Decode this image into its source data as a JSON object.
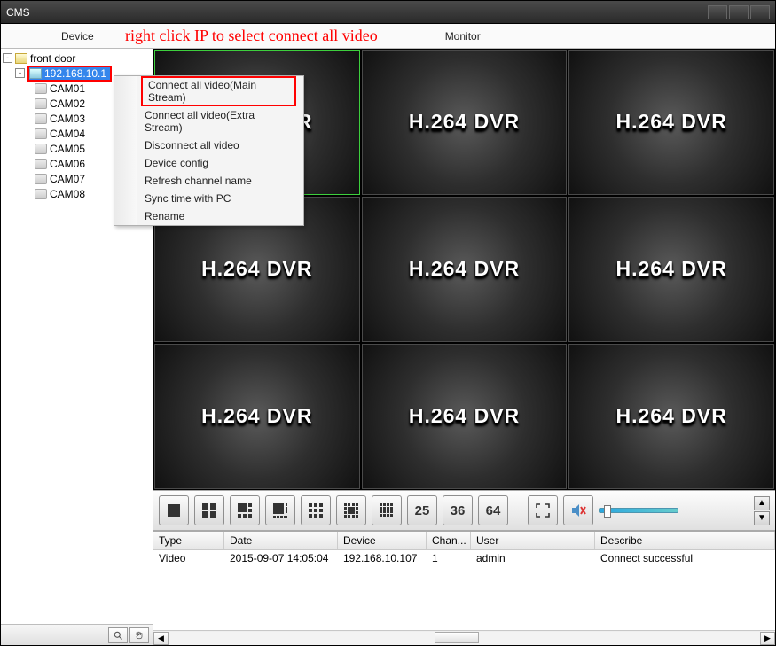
{
  "window": {
    "title": "CMS"
  },
  "menu": {
    "device": "Device",
    "monitor": "Monitor"
  },
  "annotation": "right click IP to select connect all video",
  "tree": {
    "root": "front door",
    "device_ip": "192.168.10.1",
    "cams": [
      "CAM01",
      "CAM02",
      "CAM03",
      "CAM04",
      "CAM05",
      "CAM06",
      "CAM07",
      "CAM08"
    ]
  },
  "context_menu": {
    "items": [
      "Connect all video(Main Stream)",
      "Connect all video(Extra Stream)",
      "Disconnect all video",
      "Device config",
      "Refresh channel name",
      "Sync time with PC",
      "Rename"
    ]
  },
  "video_placeholder": "H.264 DVR",
  "layout_buttons": {
    "n25": "25",
    "n36": "36",
    "n64": "64"
  },
  "log": {
    "headers": {
      "type": "Type",
      "date": "Date",
      "device": "Device",
      "chan": "Chan...",
      "user": "User",
      "desc": "Describe"
    },
    "rows": [
      {
        "type": "Video",
        "date": "2015-09-07 14:05:04",
        "device": "192.168.10.107",
        "chan": "1",
        "user": "admin",
        "desc": "Connect successful"
      }
    ]
  }
}
